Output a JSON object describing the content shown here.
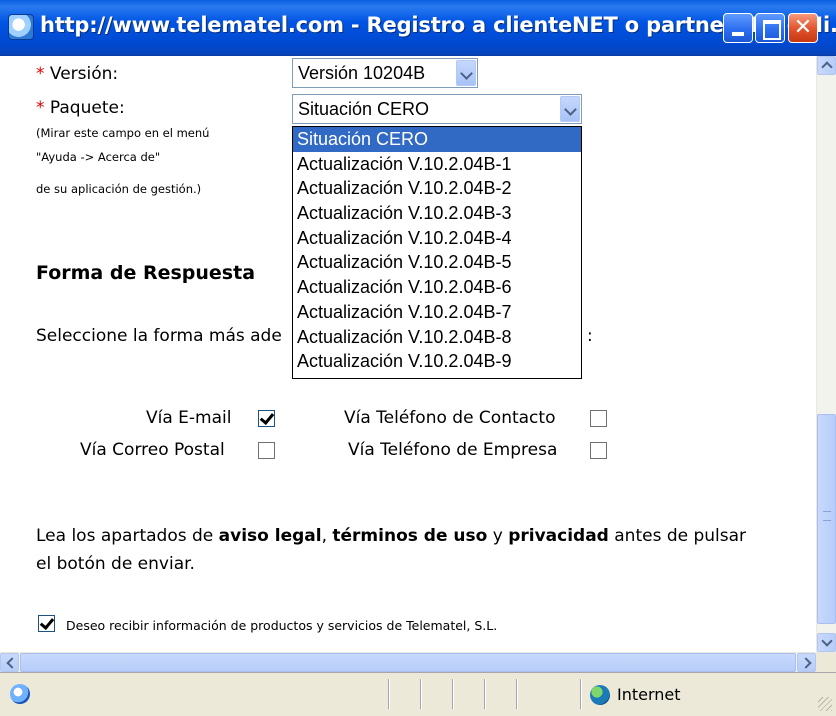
{
  "window": {
    "title": "http://www.telematel.com - Registro a clienteNET o partnerNET - Mi...",
    "close_glyph": "✕"
  },
  "form": {
    "required_mark": "*",
    "version_label": "Versión:",
    "version_value": "Versión 10204B",
    "package_label": "Paquete:",
    "package_value": "Situación CERO",
    "help_line1": "(Mirar este campo en el menú",
    "help_line2": "\"Ayuda -> Acerca de\"",
    "help_line3": "de su aplicación de gestión.)",
    "package_options": [
      "Situación CERO",
      "Actualización V.10.2.04B-1",
      "Actualización V.10.2.04B-2",
      "Actualización V.10.2.04B-3",
      "Actualización V.10.2.04B-4",
      "Actualización V.10.2.04B-5",
      "Actualización V.10.2.04B-6",
      "Actualización V.10.2.04B-7",
      "Actualización V.10.2.04B-8",
      "Actualización V.10.2.04B-9"
    ]
  },
  "response": {
    "heading": "Forma de Respuesta",
    "instruction_visible": "Seleccione la forma más ade",
    "instruction_tail": ":",
    "options": {
      "email": "Vía E-mail",
      "postal": "Vía Correo Postal",
      "contact_phone": "Vía Teléfono de Contacto",
      "company_phone": "Vía Teléfono de Empresa"
    },
    "checked": {
      "email": true,
      "postal": false,
      "contact_phone": false,
      "company_phone": false
    }
  },
  "legal": {
    "pre": "Lea los apartados de ",
    "aviso": "aviso legal",
    "comma": ", ",
    "terminos": "términos de uso",
    "y": " y ",
    "privacidad": "privacidad",
    "post1": " antes de pulsar",
    "line2": "el botón de enviar."
  },
  "newsletter": {
    "label": "Deseo recibir información de productos y servicios de Telematel, S.L.",
    "checked": true
  },
  "statusbar": {
    "zone": "Internet"
  }
}
